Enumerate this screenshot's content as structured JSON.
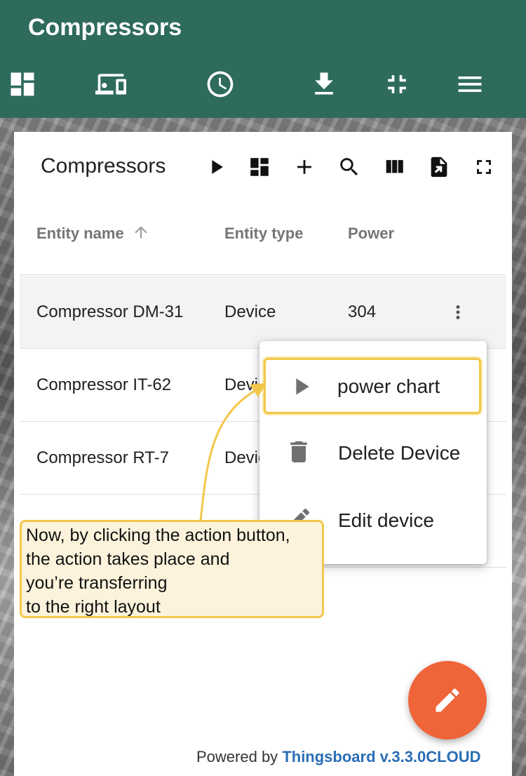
{
  "header": {
    "title": "Compressors",
    "toolbar": [
      "dashboard-icon",
      "devices-icon",
      "history-icon",
      "download-icon",
      "exit-fullscreen-icon",
      "menu-icon"
    ]
  },
  "widget": {
    "title": "Compressors",
    "tools": [
      "play-icon",
      "dashboard-icon",
      "add-icon",
      "search-icon",
      "columns-icon",
      "export-icon",
      "fullscreen-icon"
    ],
    "columns": [
      "Entity name",
      "Entity type",
      "Power"
    ],
    "rows": [
      {
        "name": "Compressor DM-31",
        "type": "Device",
        "power": "304"
      },
      {
        "name": "Compressor IT-62",
        "type": "Device",
        "power": ""
      },
      {
        "name": "Compressor RT-7",
        "type": "Device",
        "power": ""
      }
    ]
  },
  "menu": {
    "items": [
      {
        "label": "power chart",
        "icon": "play-icon"
      },
      {
        "label": "Delete Device",
        "icon": "delete-icon"
      },
      {
        "label": "Edit device",
        "icon": "edit-icon"
      }
    ]
  },
  "callout": {
    "lines": [
      "Now, by clicking the action button,",
      "the action takes place and",
      "you’re transferring",
      "to the right layout"
    ]
  },
  "footer": {
    "prefix": "Powered by",
    "brand": "Thingsboard v.3.3.0CLOUD"
  },
  "colors": {
    "header": "#2e6b5d",
    "fab": "#f0643a",
    "highlight": "#f3c74b",
    "brand_link": "#2a6db5"
  }
}
